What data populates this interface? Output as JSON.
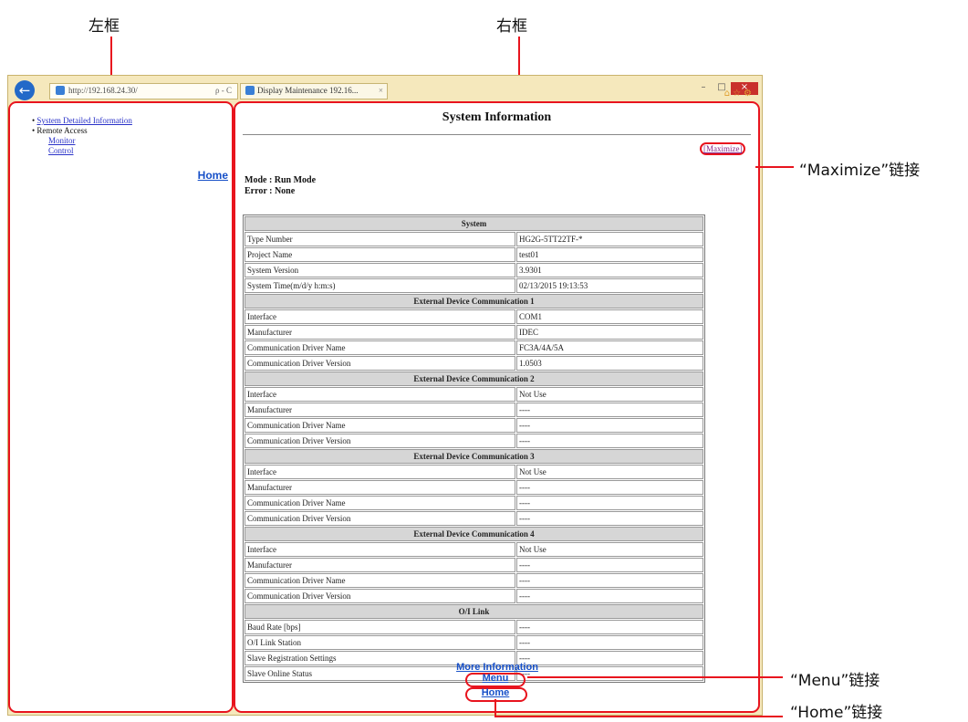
{
  "callouts": {
    "left_frame": "左框",
    "right_frame": "右框",
    "maximize": "“Maximize”链接",
    "menu": "“Menu”链接",
    "home": "“Home”链接"
  },
  "browser": {
    "address": "http://192.168.24.30/",
    "tab_title": "Display Maintenance 192.16...",
    "address_tools": "ρ - C"
  },
  "left_frame": {
    "system_detailed_information": "System Detailed Information",
    "remote_access": "Remote Access",
    "monitor": "Monitor",
    "control": "Control",
    "home": "Home"
  },
  "right_frame": {
    "title": "System Information",
    "maximize_link": "[Maximize]",
    "mode": "Mode : Run Mode",
    "error": "Error : None",
    "more_information": "More Information",
    "menu": "Menu",
    "home": "Home"
  },
  "table": {
    "sections": [
      {
        "title": "System",
        "rows": [
          {
            "key": "Type Number",
            "value": "HG2G-5TT22TF-*"
          },
          {
            "key": "Project Name",
            "value": "test01"
          },
          {
            "key": "System Version",
            "value": "3.9301"
          },
          {
            "key": "System Time(m/d/y h:m:s)",
            "value": "02/13/2015 19:13:53"
          }
        ]
      },
      {
        "title": "External Device Communication 1",
        "rows": [
          {
            "key": "Interface",
            "value": "COM1"
          },
          {
            "key": "Manufacturer",
            "value": "IDEC"
          },
          {
            "key": "Communication Driver Name",
            "value": "FC3A/4A/5A"
          },
          {
            "key": "Communication Driver Version",
            "value": "1.0503"
          }
        ]
      },
      {
        "title": "External Device Communication 2",
        "rows": [
          {
            "key": "Interface",
            "value": "Not Use"
          },
          {
            "key": "Manufacturer",
            "value": "----"
          },
          {
            "key": "Communication Driver Name",
            "value": "----"
          },
          {
            "key": "Communication Driver Version",
            "value": "----"
          }
        ]
      },
      {
        "title": "External Device Communication 3",
        "rows": [
          {
            "key": "Interface",
            "value": "Not Use"
          },
          {
            "key": "Manufacturer",
            "value": "----"
          },
          {
            "key": "Communication Driver Name",
            "value": "----"
          },
          {
            "key": "Communication Driver Version",
            "value": "----"
          }
        ]
      },
      {
        "title": "External Device Communication 4",
        "rows": [
          {
            "key": "Interface",
            "value": "Not Use"
          },
          {
            "key": "Manufacturer",
            "value": "----"
          },
          {
            "key": "Communication Driver Name",
            "value": "----"
          },
          {
            "key": "Communication Driver Version",
            "value": "----"
          }
        ]
      },
      {
        "title": "O/I Link",
        "rows": [
          {
            "key": "Baud Rate [bps]",
            "value": "----"
          },
          {
            "key": "O/I Link Station",
            "value": "----"
          },
          {
            "key": "Slave Registration Settings",
            "value": "----"
          },
          {
            "key": "Slave Online Status",
            "value": "----"
          }
        ]
      }
    ]
  }
}
